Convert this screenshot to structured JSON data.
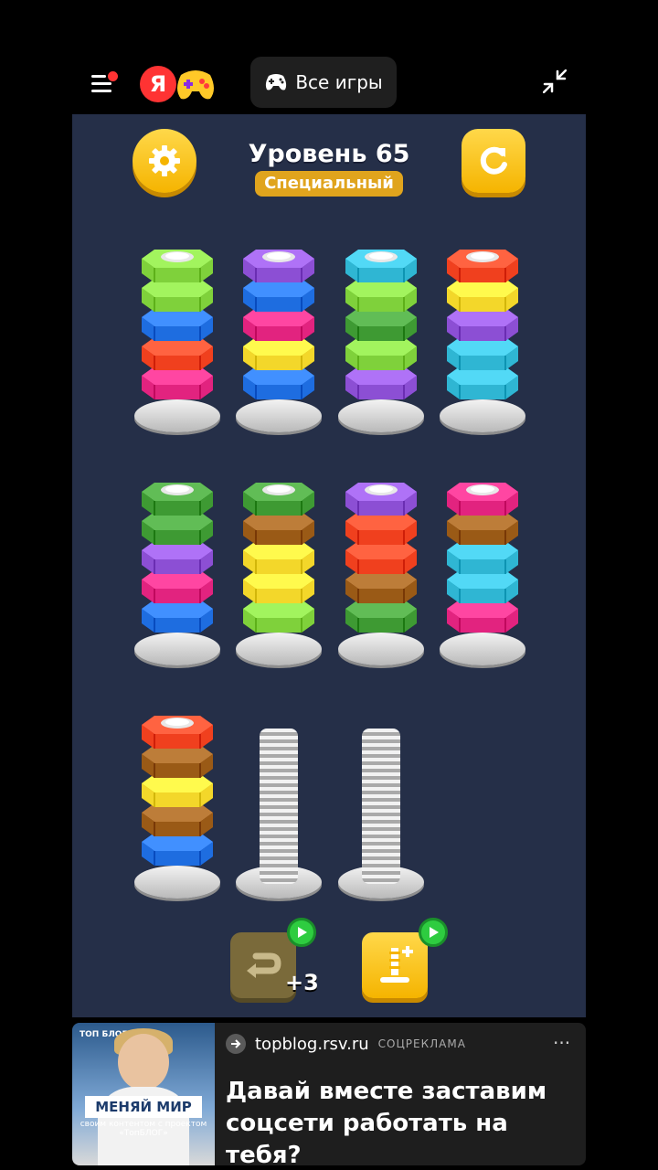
{
  "header": {
    "all_games_label": "Все игры",
    "logo_letter": "Я",
    "notification_dot": true
  },
  "game": {
    "level_title": "Уровень 65",
    "level_badge": "Специальный",
    "undo_count": "+3",
    "background": "#252f48",
    "rows": [
      [
        [
          "#7fd13b",
          "#7fd13b",
          "#1e6de0",
          "#f0401e",
          "#e2237f"
        ],
        [
          "#8c4fd4",
          "#1e6de0",
          "#e2237f",
          "#f3d72a",
          "#1e6de0"
        ],
        [
          "#2fb6d3",
          "#7fd13b",
          "#3e9a33",
          "#7fd13b",
          "#8c4fd4"
        ],
        [
          "#f0401e",
          "#f3d72a",
          "#8c4fd4",
          "#2fb6d3",
          "#2fb6d3"
        ]
      ],
      [
        [
          "#3e9a33",
          "#3e9a33",
          "#8c4fd4",
          "#e2237f",
          "#1e6de0"
        ],
        [
          "#3e9a33",
          "#9a5a16",
          "#f3d72a",
          "#f3d72a",
          "#7fd13b"
        ],
        [
          "#8c4fd4",
          "#f0401e",
          "#f0401e",
          "#9a5a16",
          "#3e9a33"
        ],
        [
          "#e2237f",
          "#9a5a16",
          "#2fb6d3",
          "#2fb6d3",
          "#e2237f"
        ]
      ],
      [
        [
          "#f0401e",
          "#9a5a16",
          "#f3d72a",
          "#9a5a16",
          "#1e6de0"
        ],
        [],
        []
      ]
    ]
  },
  "ad": {
    "domain": "topblog.rsv.ru",
    "tag": "СОЦРЕКЛАМА",
    "text": "Давай вместе заставим соцсети работать на тебя?",
    "image_headline": "МЕНЯЙ МИР",
    "image_sub": "своим контентом с проектом «ТопБЛОГ»",
    "image_brand": "ТОП БЛОГ",
    "more_label": "···"
  }
}
